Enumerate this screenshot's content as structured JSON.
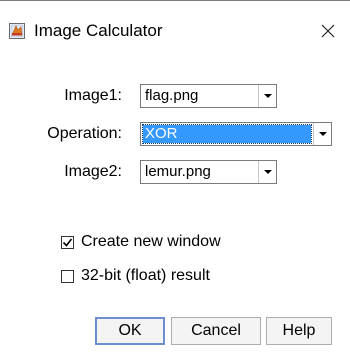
{
  "window": {
    "title": "Image Calculator"
  },
  "fields": {
    "image1": {
      "label": "Image1:",
      "value": "flag.png"
    },
    "operation": {
      "label": "Operation:",
      "value": "XOR"
    },
    "image2": {
      "label": "Image2:",
      "value": "lemur.png"
    }
  },
  "options": {
    "create_new_window": {
      "label": "Create new window",
      "checked": true
    },
    "float_result": {
      "label": "32-bit (float) result",
      "checked": false
    }
  },
  "buttons": {
    "ok": "OK",
    "cancel": "Cancel",
    "help": "Help"
  },
  "colors": {
    "selection": "#3399ff",
    "default_button_border": "#6e8fcf"
  },
  "icons": {
    "app": "imagej-icon",
    "close": "close-icon",
    "dropdown": "chevron-down-icon",
    "check": "checkmark-icon"
  }
}
